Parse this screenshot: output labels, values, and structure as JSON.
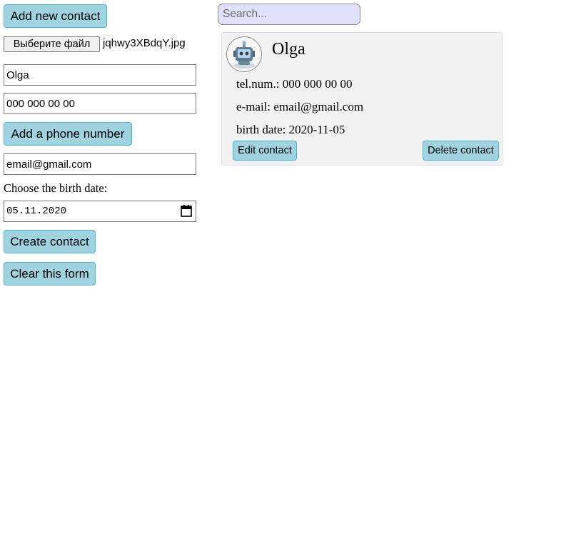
{
  "form": {
    "add_new_contact_label": "Add new contact",
    "file_button_label": "Выберите файл",
    "file_name": "jqhwy3XBdqY.jpg",
    "name_value": "Olga",
    "phone_value": "000 000 00 00",
    "add_phone_label": "Add a phone number",
    "email_value": "email@gmail.com",
    "birth_date_label": "Choose the birth date:",
    "birth_date_value": "05.11.2020",
    "create_label": "Create contact",
    "clear_label": "Clear this form"
  },
  "search": {
    "placeholder": "Search..."
  },
  "contacts": [
    {
      "name": "Olga",
      "tel_label": "tel.num.:",
      "tel": "000 000 00 00",
      "email_label": "e-mail:",
      "email": "email@gmail.com",
      "birth_label": "birth date:",
      "birth_date": "2020-11-05",
      "edit_label": "Edit contact",
      "delete_label": "Delete contact",
      "avatar_icon": "robot-avatar-icon"
    }
  ],
  "colors": {
    "button_bg": "#9fd3e0",
    "button_border": "#47b6c7",
    "search_bg": "#e0e0fb",
    "card_bg": "#f1f1f1"
  }
}
